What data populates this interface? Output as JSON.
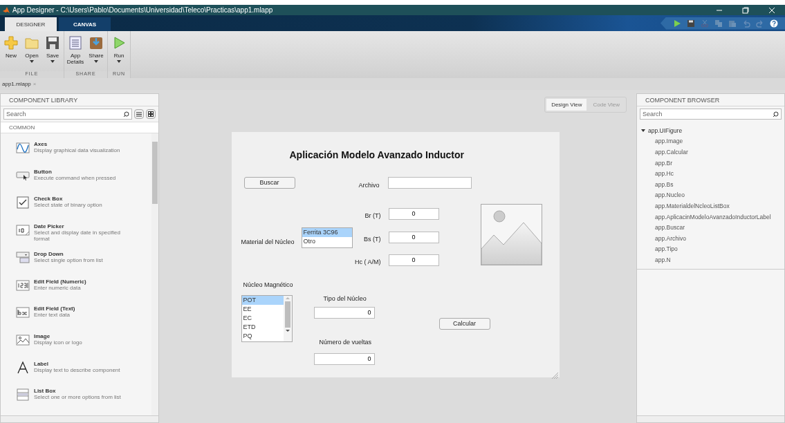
{
  "window": {
    "title": "App Designer - C:\\Users\\Pablo\\Documents\\Universidad\\Teleco\\Practicas\\app1.mlapp"
  },
  "tabs": [
    {
      "label": "DESIGNER",
      "selected": true
    },
    {
      "label": "CANVAS",
      "selected": false
    }
  ],
  "ribbon": {
    "groups": [
      {
        "label": "FILE",
        "buttons": [
          {
            "label": "New",
            "kind": "new",
            "dropdown": false
          },
          {
            "label": "Open",
            "kind": "open",
            "dropdown": true
          },
          {
            "label": "Save",
            "kind": "save",
            "dropdown": true
          }
        ]
      },
      {
        "label": "SHARE",
        "buttons": [
          {
            "label": "App Details",
            "kind": "details",
            "dropdown": false
          },
          {
            "label": "Share",
            "kind": "share",
            "dropdown": true
          }
        ]
      },
      {
        "label": "RUN",
        "buttons": [
          {
            "label": "Run",
            "kind": "run",
            "dropdown": true
          }
        ]
      }
    ]
  },
  "quick_access": [
    {
      "kind": "run",
      "disabled": false
    },
    {
      "kind": "save",
      "disabled": false
    },
    {
      "kind": "cut",
      "disabled": true
    },
    {
      "kind": "copy",
      "disabled": true
    },
    {
      "kind": "paste",
      "disabled": true
    },
    {
      "kind": "undo",
      "disabled": true
    },
    {
      "kind": "redo",
      "disabled": true
    },
    {
      "kind": "help",
      "disabled": false
    }
  ],
  "document_tab": {
    "label": "app1.mlapp",
    "close": "×"
  },
  "component_library": {
    "title": "COMPONENT LIBRARY",
    "search": {
      "placeholder": "Search"
    },
    "section": "COMMON",
    "items": [
      {
        "name": "Axes",
        "description": "Display graphical data visualization",
        "kind": "axes"
      },
      {
        "name": "Button",
        "description": "Execute command when pressed",
        "kind": "button"
      },
      {
        "name": "Check Box",
        "description": "Select state of binary option",
        "kind": "checkbox"
      },
      {
        "name": "Date Picker",
        "description": "Select and display date in specified format",
        "kind": "date"
      },
      {
        "name": "Drop Down",
        "description": "Select single option from list",
        "kind": "dropdown"
      },
      {
        "name": "Edit Field (Numeric)",
        "description": "Enter numeric data",
        "kind": "numeric"
      },
      {
        "name": "Edit Field (Text)",
        "description": "Enter text data",
        "kind": "text"
      },
      {
        "name": "Image",
        "description": "Display icon or logo",
        "kind": "image"
      },
      {
        "name": "Label",
        "description": "Display text to describe component",
        "kind": "label"
      },
      {
        "name": "List Box",
        "description": "Select one or more options from list",
        "kind": "listbox"
      }
    ]
  },
  "view_switch": [
    {
      "label": "Design View",
      "selected": true
    },
    {
      "label": "Code View",
      "selected": false
    }
  ],
  "figure": {
    "title": "Aplicación Modelo Avanzado Inductor",
    "buscar_button": "Buscar",
    "archivo_label": "Archivo",
    "material_label": "Material del Núcleo",
    "material_options": [
      {
        "label": "Ferrita 3C96",
        "selected": true
      },
      {
        "label": "Otro",
        "selected": false
      }
    ],
    "fields": [
      {
        "label": "Br (T)",
        "value": "0"
      },
      {
        "label": "Bs (T)",
        "value": "0"
      },
      {
        "label": "Hc ( A/M)",
        "value": "0"
      }
    ],
    "nucleo_label": "Núcleo Magnético",
    "nucleo_options": [
      {
        "label": "POT",
        "selected": true
      },
      {
        "label": "EE",
        "selected": false
      },
      {
        "label": "EC",
        "selected": false
      },
      {
        "label": "ETD",
        "selected": false
      },
      {
        "label": "PQ",
        "selected": false
      }
    ],
    "tipo_label": "Tipo del Núcleo",
    "tipo_value": "0",
    "calcular_button": "Calcular",
    "vueltas_label": "Número de vueltas",
    "vueltas_value": "0"
  },
  "component_browser": {
    "title": "COMPONENT BROWSER",
    "search": {
      "placeholder": "Search"
    },
    "tree": [
      {
        "label": "app.UIFigure",
        "expanded": true,
        "children": [
          {
            "label": "app.Image"
          },
          {
            "label": "app.Calcular"
          },
          {
            "label": "app.Br"
          },
          {
            "label": "app.Hc"
          },
          {
            "label": "app.Bs"
          },
          {
            "label": "app.Nucleo"
          },
          {
            "label": "app.MaterialdelNcleoListBox"
          },
          {
            "label": "app.AplicacinModeloAvanzadoInductorLabel"
          },
          {
            "label": "app.Buscar"
          },
          {
            "label": "app.Archivo"
          },
          {
            "label": "app.Tipo"
          },
          {
            "label": "app.N"
          }
        ]
      }
    ]
  }
}
